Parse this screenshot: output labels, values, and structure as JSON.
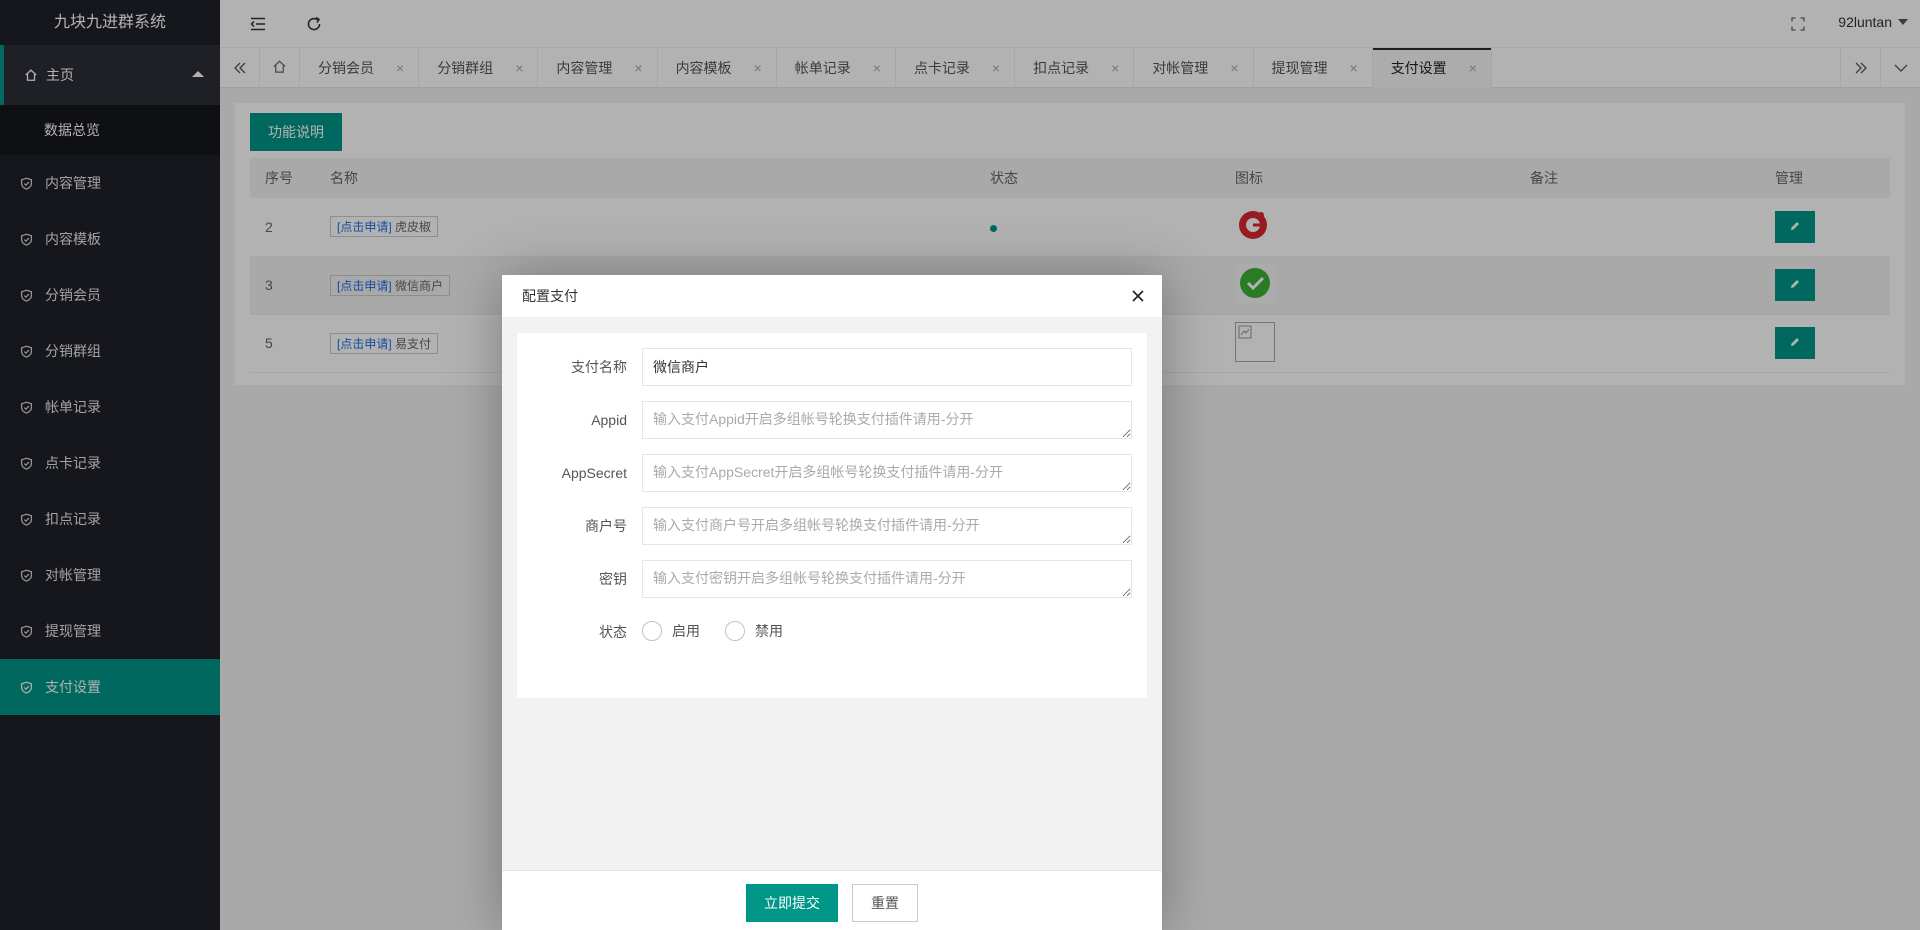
{
  "app": {
    "title": "九块九进群系统"
  },
  "sidebar": {
    "main": {
      "label": "主页",
      "icon": "home-icon"
    },
    "sub": [
      {
        "label": "数据总览"
      }
    ],
    "items": [
      {
        "label": "内容管理",
        "icon": "shield-check-icon"
      },
      {
        "label": "内容模板",
        "icon": "shield-check-icon"
      },
      {
        "label": "分销会员",
        "icon": "shield-check-icon"
      },
      {
        "label": "分销群组",
        "icon": "shield-check-icon"
      },
      {
        "label": "帐单记录",
        "icon": "shield-check-icon"
      },
      {
        "label": "点卡记录",
        "icon": "shield-check-icon"
      },
      {
        "label": "扣点记录",
        "icon": "shield-check-icon"
      },
      {
        "label": "对帐管理",
        "icon": "shield-check-icon"
      },
      {
        "label": "提现管理",
        "icon": "shield-check-icon"
      },
      {
        "label": "支付设置",
        "icon": "shield-check-icon",
        "active": true
      }
    ]
  },
  "header": {
    "username": "92luntan"
  },
  "tabs": [
    {
      "label": "分销会员"
    },
    {
      "label": "分销群组"
    },
    {
      "label": "内容管理"
    },
    {
      "label": "内容模板"
    },
    {
      "label": "帐单记录"
    },
    {
      "label": "点卡记录"
    },
    {
      "label": "扣点记录"
    },
    {
      "label": "对帐管理"
    },
    {
      "label": "提现管理"
    },
    {
      "label": "支付设置",
      "active": true
    }
  ],
  "tab_close_glyph": "×",
  "page": {
    "func_button": "功能说明",
    "table": {
      "headers": [
        "序号",
        "名称",
        "状态",
        "图标",
        "备注",
        "管理"
      ],
      "apply_link": "[点击申请]",
      "rows": [
        {
          "id": "2",
          "name": "虎皮椒",
          "status": "enabled",
          "icon": "hupijiao-logo-icon"
        },
        {
          "id": "3",
          "name": "微信商户",
          "status": "",
          "icon": "wechat-logo-icon"
        },
        {
          "id": "5",
          "name": "易支付",
          "status": "",
          "icon": "broken-image-icon"
        }
      ]
    }
  },
  "modal": {
    "title": "配置支付",
    "fields": {
      "pay_name": {
        "label": "支付名称",
        "value": "微信商户"
      },
      "appid": {
        "label": "Appid",
        "placeholder": "输入支付Appid开启多组帐号轮换支付插件请用-分开"
      },
      "appsecret": {
        "label": "AppSecret",
        "placeholder": "输入支付AppSecret开启多组帐号轮换支付插件请用-分开"
      },
      "merchant_no": {
        "label": "商户号",
        "placeholder": "输入支付商户号开启多组帐号轮换支付插件请用-分开"
      },
      "secret_key": {
        "label": "密钥",
        "placeholder": "输入支付密钥开启多组帐号轮换支付插件请用-分开"
      },
      "status": {
        "label": "状态",
        "options": [
          "启用",
          "禁用"
        ]
      }
    },
    "submit": "立即提交",
    "reset": "重置"
  },
  "colors": {
    "accent": "#009688",
    "sidebar_bg": "#20222a",
    "link": "#1e6fe8"
  }
}
